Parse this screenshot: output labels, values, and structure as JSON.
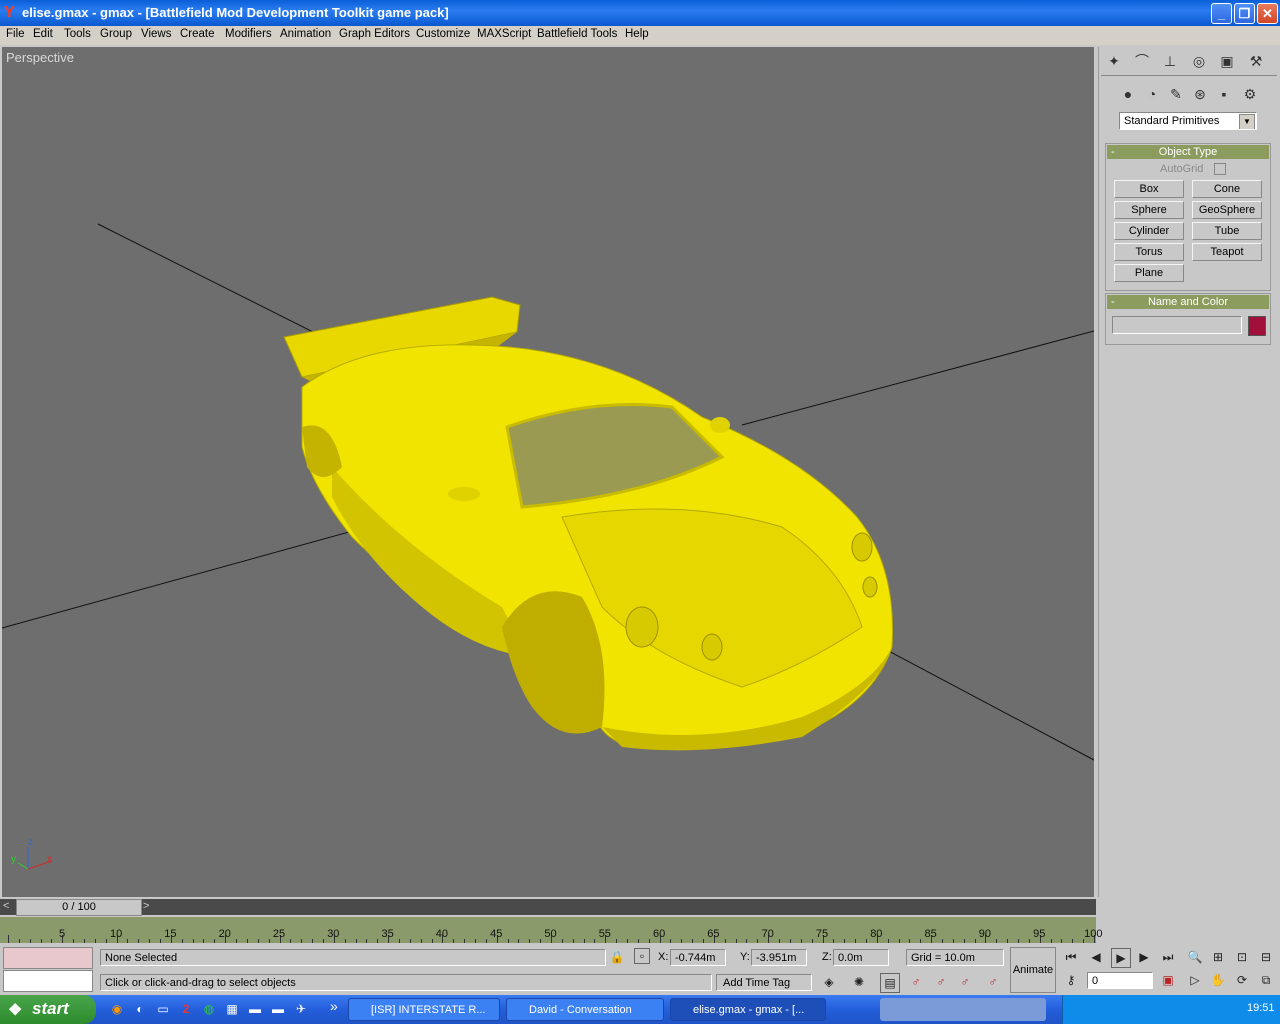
{
  "window": {
    "title": "elise.gmax - gmax - [Battlefield Mod Development Toolkit game pack]",
    "minimize": "_",
    "maximize": "❐",
    "close": "✕"
  },
  "menu": [
    "File",
    "Edit",
    "Tools",
    "Group",
    "Views",
    "Create",
    "Modifiers",
    "Animation",
    "Graph Editors",
    "Customize",
    "MAXScript",
    "Battlefield Tools",
    "Help"
  ],
  "viewport": {
    "label": "Perspective",
    "axis_x": "x",
    "axis_y": "y",
    "axis_z": "z",
    "model_color": "#f0e400"
  },
  "command_panel": {
    "dropdown": "Standard Primitives",
    "object_type": {
      "header": "Object Type",
      "collapse": "-",
      "autogrid": "AutoGrid",
      "buttons": [
        "Box",
        "Cone",
        "Sphere",
        "GeoSphere",
        "Cylinder",
        "Tube",
        "Torus",
        "Teapot",
        "Plane"
      ]
    },
    "name_color": {
      "header": "Name and Color",
      "collapse": "-",
      "name_value": "",
      "color": "#a0103a"
    }
  },
  "timeline": {
    "slider_text": "0 / 100",
    "prev": "<",
    "next": ">",
    "ticks": [
      "5",
      "10",
      "15",
      "20",
      "25",
      "30",
      "35",
      "40",
      "45",
      "50",
      "55",
      "60",
      "65",
      "70",
      "75",
      "80",
      "85",
      "90",
      "95",
      "100"
    ]
  },
  "status": {
    "selection": "None Selected",
    "prompt": "Click or click-and-drag to select objects",
    "x_label": "X:",
    "x_value": "-0.744m",
    "y_label": "Y:",
    "y_value": "-3.951m",
    "z_label": "Z:",
    "z_value": "0.0m",
    "grid": "Grid = 10.0m",
    "add_time_tag": "Add Time Tag",
    "animate": "Animate",
    "frame": "0"
  },
  "taskbar": {
    "start": "start",
    "tasks": [
      "[ISR] INTERSTATE R...",
      "David - Conversation",
      "elise.gmax - gmax - [..."
    ],
    "overflow": "»",
    "clock": "19:51"
  }
}
